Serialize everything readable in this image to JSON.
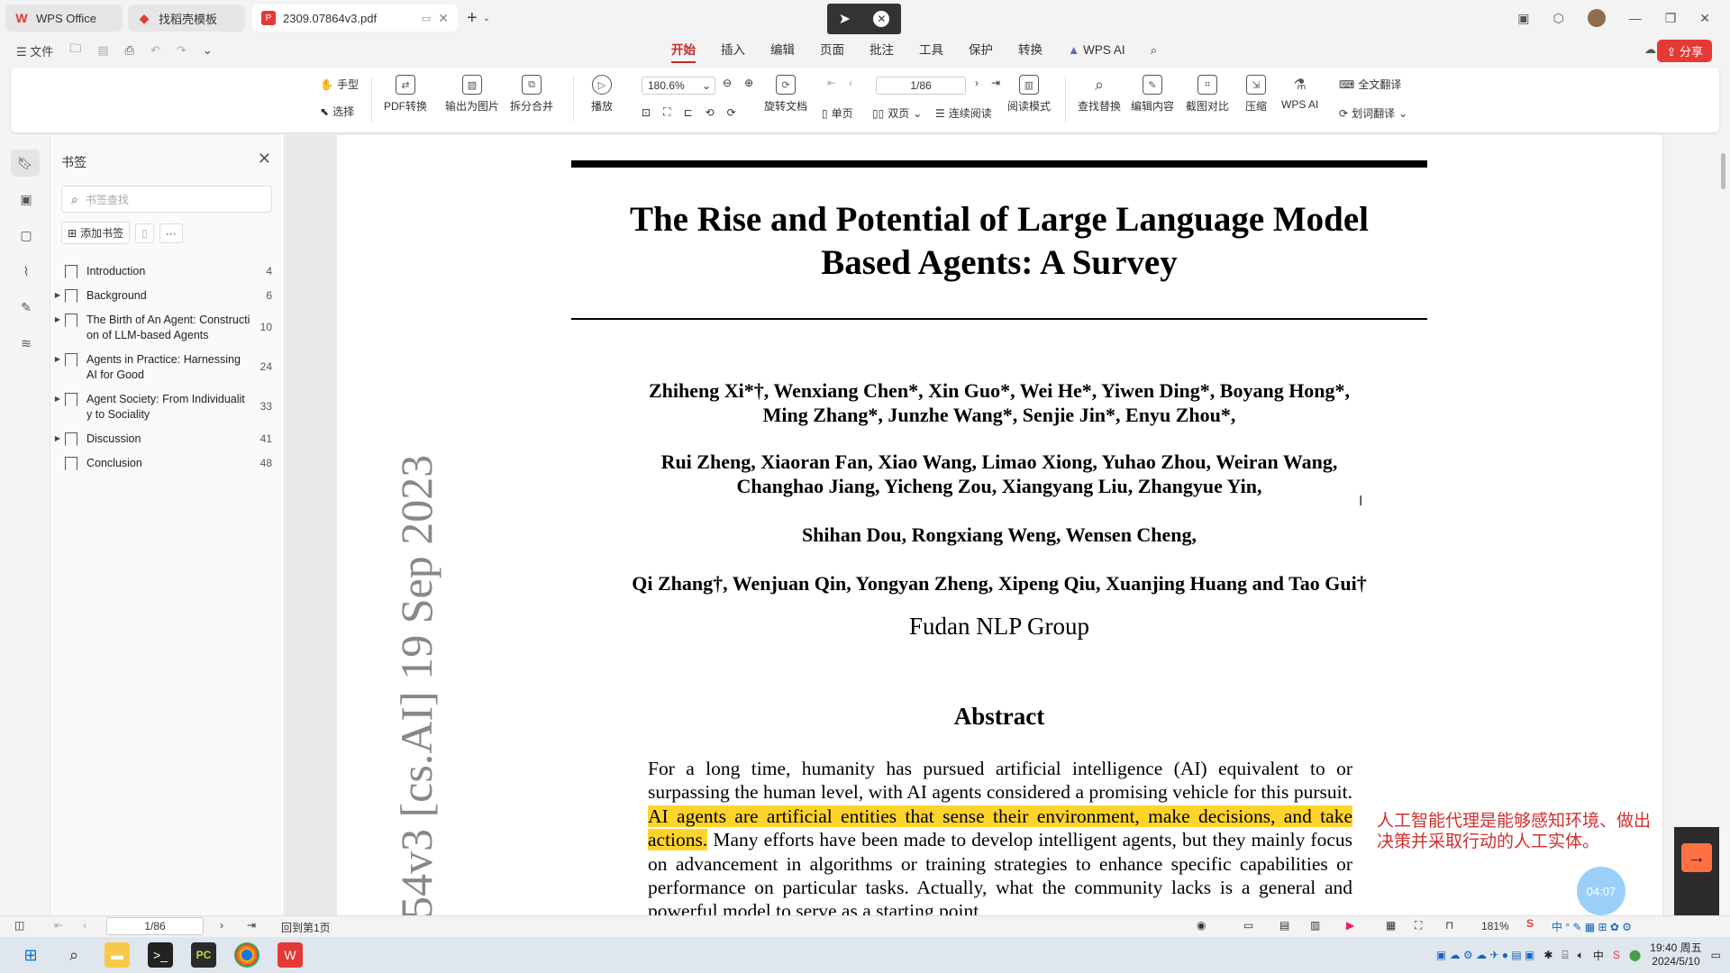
{
  "tabs": [
    {
      "label": "WPS Office",
      "active": false
    },
    {
      "label": "找稻壳模板",
      "active": false
    },
    {
      "label": "2309.07864v3.pdf",
      "active": true
    }
  ],
  "menubar": {
    "file_label": "文件",
    "menus": [
      "开始",
      "插入",
      "编辑",
      "页面",
      "批注",
      "工具",
      "保护",
      "转换",
      "WPS AI"
    ],
    "active_menu": "开始",
    "share_label": "分享"
  },
  "ribbon": {
    "hand": "手型",
    "select": "选择",
    "pdf_convert": "PDF转换",
    "export_image": "输出为图片",
    "split_merge": "拆分合并",
    "play": "播放",
    "zoom": "180.6%",
    "rotate": "旋转文档",
    "page_indicator": "1/86",
    "single_page": "单页",
    "double_page": "双页",
    "continuous": "连续阅读",
    "read_mode": "阅读模式",
    "find_replace": "查找替换",
    "edit_content": "编辑内容",
    "screenshot_compare": "截图对比",
    "compress": "压缩",
    "wps_ai": "WPS AI",
    "full_translate": "全文翻译",
    "word_translate": "划词翻译"
  },
  "bookmarks": {
    "title": "书签",
    "search_placeholder": "书签查找",
    "add_label": "添加书签",
    "items": [
      {
        "label": "Introduction",
        "page": "4",
        "expandable": false
      },
      {
        "label": "Background",
        "page": "6",
        "expandable": true
      },
      {
        "label": "The Birth of An Agent: Construction of LLM-based Agents",
        "page": "10",
        "expandable": true
      },
      {
        "label": "Agents in Practice: Harnessing AI for Good",
        "page": "24",
        "expandable": true
      },
      {
        "label": "Agent Society: From Individuality to Sociality",
        "page": "33",
        "expandable": true
      },
      {
        "label": "Discussion",
        "page": "41",
        "expandable": true
      },
      {
        "label": "Conclusion",
        "page": "48",
        "expandable": false
      }
    ]
  },
  "document": {
    "title_line1": "The Rise and Potential of Large Language Model",
    "title_line2": "Based Agents: A Survey",
    "authors_1a": "Zhiheng Xi*†, Wenxiang Chen*, Xin Guo*, Wei He*, Yiwen Ding*, Boyang Hong*,",
    "authors_1b": "Ming Zhang*, Junzhe Wang*, Senjie Jin*, Enyu Zhou*,",
    "authors_2a": "Rui Zheng, Xiaoran Fan, Xiao Wang, Limao Xiong, Yuhao Zhou, Weiran Wang,",
    "authors_2b": "Changhao Jiang, Yicheng Zou, Xiangyang Liu, Zhangyue Yin,",
    "authors_3": "Shihan Dou, Rongxiang Weng, Wensen Cheng,",
    "authors_4": "Qi Zhang†, Wenjuan Qin, Yongyan Zheng, Xipeng Qiu, Xuanjing Huang and Tao Gui†",
    "group": "Fudan NLP Group",
    "abstract_heading": "Abstract",
    "abstract_pre": "For a long time, humanity has pursued artificial intelligence (AI) equivalent to or surpassing the human level, with AI agents considered a promising vehicle for this pursuit. ",
    "abstract_highlight": "AI agents are artificial entities that sense their environment, make decisions, and take actions.",
    "abstract_post": " Many efforts have been made to develop intelligent agents, but they mainly focus on advancement in algorithms or training strategies to enhance specific capabilities or performance on particular tasks. Actually, what the community lacks is a general and powerful model to serve as a starting point",
    "arxiv_stamp": "54v3  [cs.AI]  19 Sep 2023"
  },
  "translation_popup": "人工智能代理是能够感知环境、做出决策并采取行动的人工实体。",
  "time_bubble": "04:07",
  "statusbar": {
    "page": "1/86",
    "back_to_first": "回到第1页",
    "zoom": "181%"
  },
  "taskbar": {
    "time": "19:40 周五",
    "date": "2024/5/10",
    "ime": "中"
  },
  "colors": {
    "accent": "#c62828",
    "share_bg": "#e53935",
    "highlight": "#ffd42a",
    "translation_text": "#d32f2f"
  }
}
